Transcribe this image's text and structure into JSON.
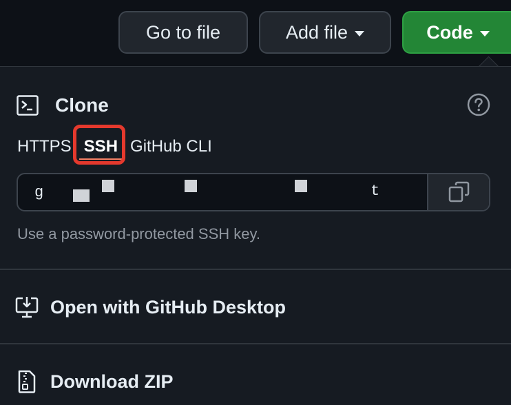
{
  "toolbar": {
    "go_to_file_label": "Go to file",
    "add_file_label": "Add file",
    "code_label": "Code"
  },
  "clone": {
    "title": "Clone",
    "tabs": [
      {
        "label": "HTTPS",
        "selected": false
      },
      {
        "label": "SSH",
        "selected": true
      },
      {
        "label": "GitHub CLI",
        "selected": false
      }
    ],
    "url_prefix": "g",
    "url_suffix": "t",
    "url_redacted": true,
    "hint": "Use a password-protected SSH key."
  },
  "menu": {
    "open_desktop_label": "Open with GitHub Desktop",
    "download_zip_label": "Download ZIP"
  },
  "icons": {
    "clone": "terminal-icon",
    "help": "question-icon",
    "copy": "copy-icon",
    "desktop": "desktop-download-icon",
    "zip": "file-zip-icon"
  },
  "colors": {
    "page_bg": "#0d1117",
    "panel_bg": "#161b22",
    "code_button": "#238636",
    "highlight": "#e5392d",
    "muted_text": "#9198a1"
  }
}
